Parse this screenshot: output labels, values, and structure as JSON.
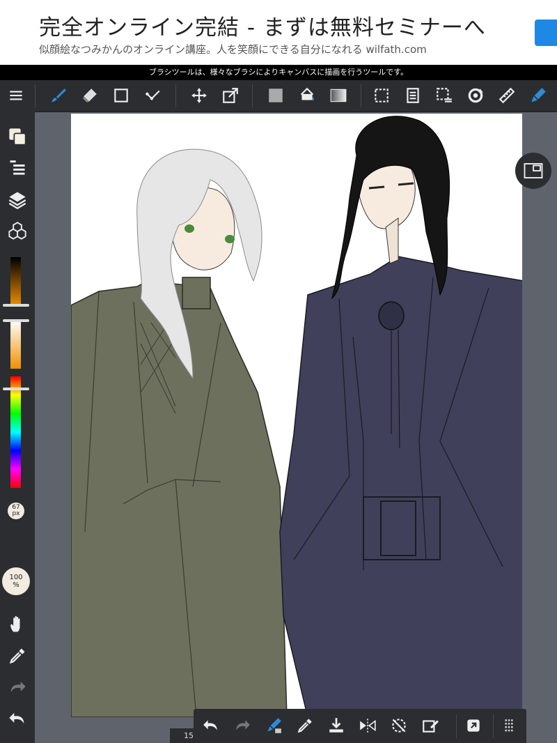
{
  "ad": {
    "title": "完全オンライン完結 - まずは無料セミナーへ",
    "subtitle": "似顔絵なつみかんのオンライン講座。人を笑顔にできる自分になれる wilfath.com"
  },
  "tooltip": "ブラシツールは、様々なブラシによりキャンバスに描画を行うツールです。",
  "sidebar": {
    "brush_size": "67\npx",
    "opacity": "100\n%"
  },
  "status": {
    "page": "15"
  },
  "colors": {
    "accent": "#2e8bd8",
    "bar": "#2b2d30",
    "canvas_bg": "#5f646c"
  }
}
